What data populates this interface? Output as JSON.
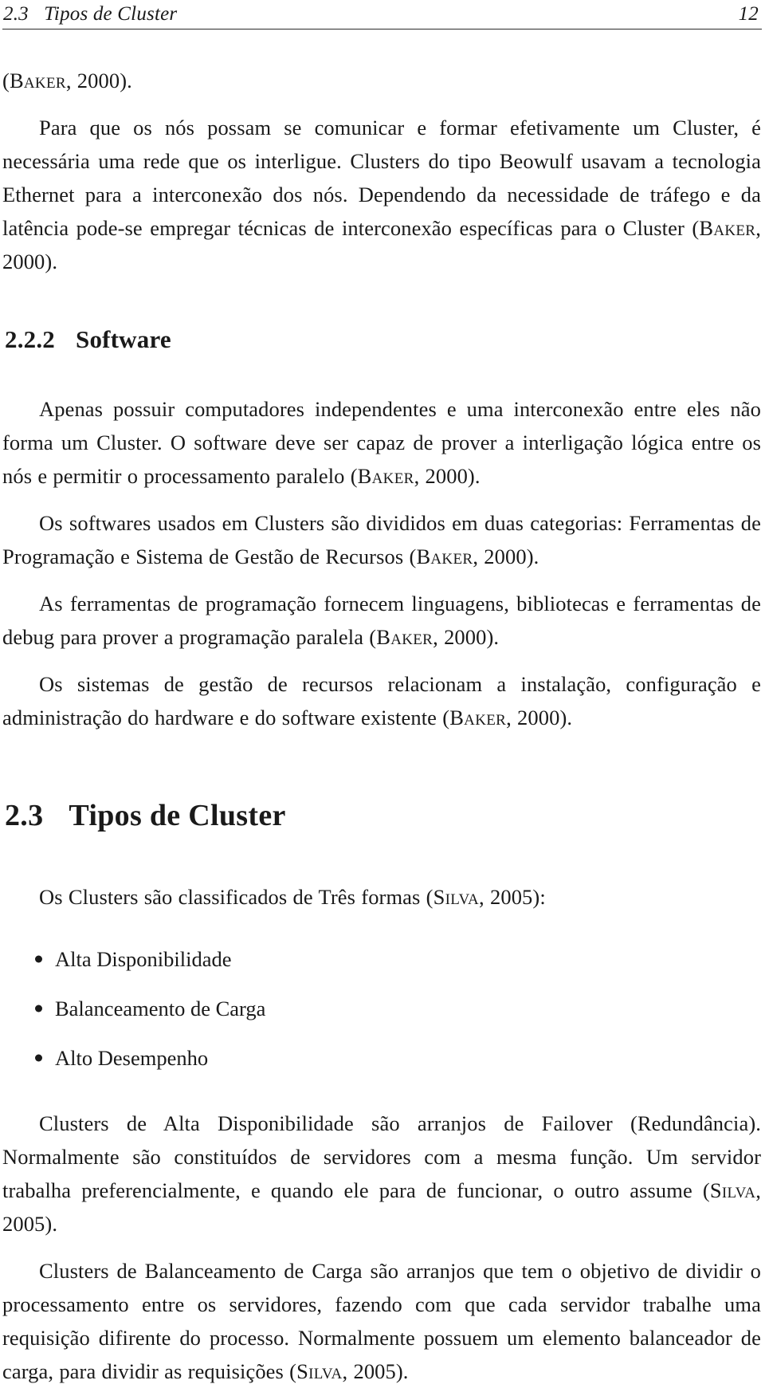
{
  "header": {
    "section_label": "2.3   Tipos de Cluster",
    "page_number": "12"
  },
  "body": {
    "carryover_line": "(BAKER, 2000).",
    "paragraph_1": "Para que os nós possam se comunicar e formar efetivamente um Cluster, é necessária uma rede que os interligue. Clusters do tipo Beowulf usavam a tecnologia Ethernet para a interconexão dos nós. Dependendo da necessidade de tráfego e da latência pode-se empregar técnicas de interconexão específicas para o Cluster (BAKER, 2000)."
  },
  "subsection": {
    "number": "2.2.2",
    "title": "Software",
    "paragraph_1": "Apenas possuir computadores independentes e uma interconexão entre eles não forma um Cluster. O software deve ser capaz de prover a interligação lógica entre os nós e permitir o processamento paralelo (BAKER, 2000).",
    "paragraph_2": "Os softwares usados em Clusters são divididos em duas categorias: Ferramentas de Programação e Sistema de Gestão de Recursos (BAKER, 2000).",
    "paragraph_3": "As ferramentas de programação fornecem linguagens, bibliotecas e ferramentas de debug para prover a programação paralela (BAKER, 2000).",
    "paragraph_4": "Os sistemas de gestão de recursos relacionam a instalação, configuração e administração do hardware e do software existente (BAKER, 2000)."
  },
  "section": {
    "number": "2.3",
    "title": "Tipos de Cluster",
    "intro": "Os Clusters são classificados de Três formas (SILVA, 2005):",
    "bullets": [
      "Alta Disponibilidade",
      "Balanceamento de Carga",
      "Alto Desempenho"
    ],
    "paragraph_1": "Clusters de Alta Disponibilidade são arranjos de Failover (Redundância). Normalmente são constituídos de servidores com a mesma função. Um servidor trabalha preferencialmente, e quando ele para de funcionar, o outro assume (SILVA, 2005).",
    "paragraph_2": "Clusters de Balanceamento de Carga são arranjos que tem o objetivo de dividir o processamento entre os servidores, fazendo com que cada servidor trabalhe uma requisição difirente do processo. Normalmente possuem um elemento balanceador de carga, para dividir as requisições (SILVA, 2005)."
  },
  "citations": {
    "baker": "BAKER",
    "baker_year": "2000",
    "silva": "SILVA",
    "silva_year": "2005"
  }
}
